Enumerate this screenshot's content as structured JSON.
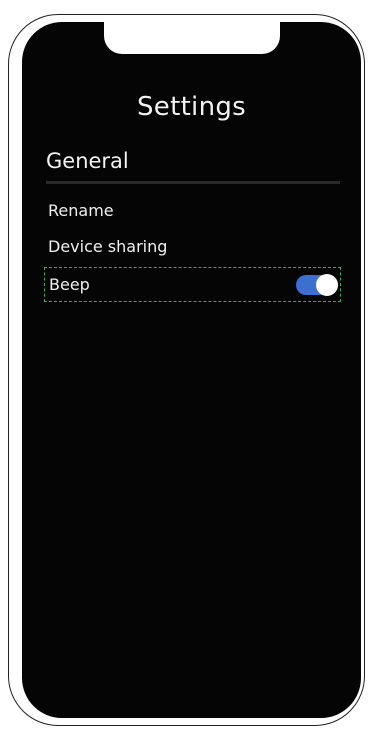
{
  "header": {
    "title": "Settings"
  },
  "sections": [
    {
      "title": "General",
      "items": [
        {
          "label": "Rename"
        },
        {
          "label": "Device sharing"
        },
        {
          "label": "Beep",
          "toggle_on": true
        }
      ]
    }
  ],
  "colors": {
    "screen_background": "#050505",
    "text": "#f0f0f0",
    "toggle_on": "#3d6fd1",
    "highlight_border": "#3fa84a"
  }
}
